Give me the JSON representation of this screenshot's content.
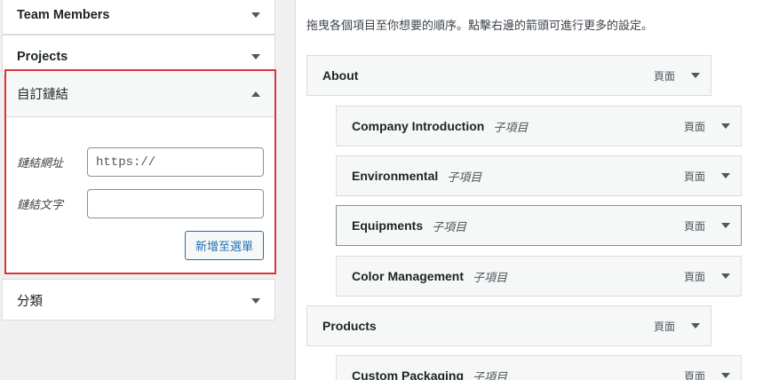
{
  "left_panel": {
    "team_members": {
      "label": "Team Members"
    },
    "projects": {
      "label": "Projects"
    },
    "custom_links": {
      "label": "自訂鏈結",
      "url_label": "鏈結網址",
      "url_placeholder": "https://",
      "text_label": "鏈結文字",
      "text_value": "",
      "add_button": "新增至選單"
    },
    "categories": {
      "label": "分類"
    }
  },
  "right_panel": {
    "instructions": "拖曳各個項目至你想要的順序。點擊右邊的箭頭可進行更多的設定。",
    "items": [
      {
        "title": "About",
        "sub": "",
        "type": "頁面",
        "depth": 0
      },
      {
        "title": "Company Introduction",
        "sub": "子項目",
        "type": "頁面",
        "depth": 1
      },
      {
        "title": "Environmental",
        "sub": "子項目",
        "type": "頁面",
        "depth": 1
      },
      {
        "title": "Equipments",
        "sub": "子項目",
        "type": "頁面",
        "depth": 1
      },
      {
        "title": "Color Management",
        "sub": "子項目",
        "type": "頁面",
        "depth": 1
      },
      {
        "title": "Products",
        "sub": "",
        "type": "頁面",
        "depth": 0
      },
      {
        "title": "Custom Packaging",
        "sub": "子項目",
        "type": "頁面",
        "depth": 1
      }
    ]
  },
  "colors": {
    "highlight_border": "#d63638",
    "accent": "#2271b1",
    "background": "#f0f0f1"
  }
}
